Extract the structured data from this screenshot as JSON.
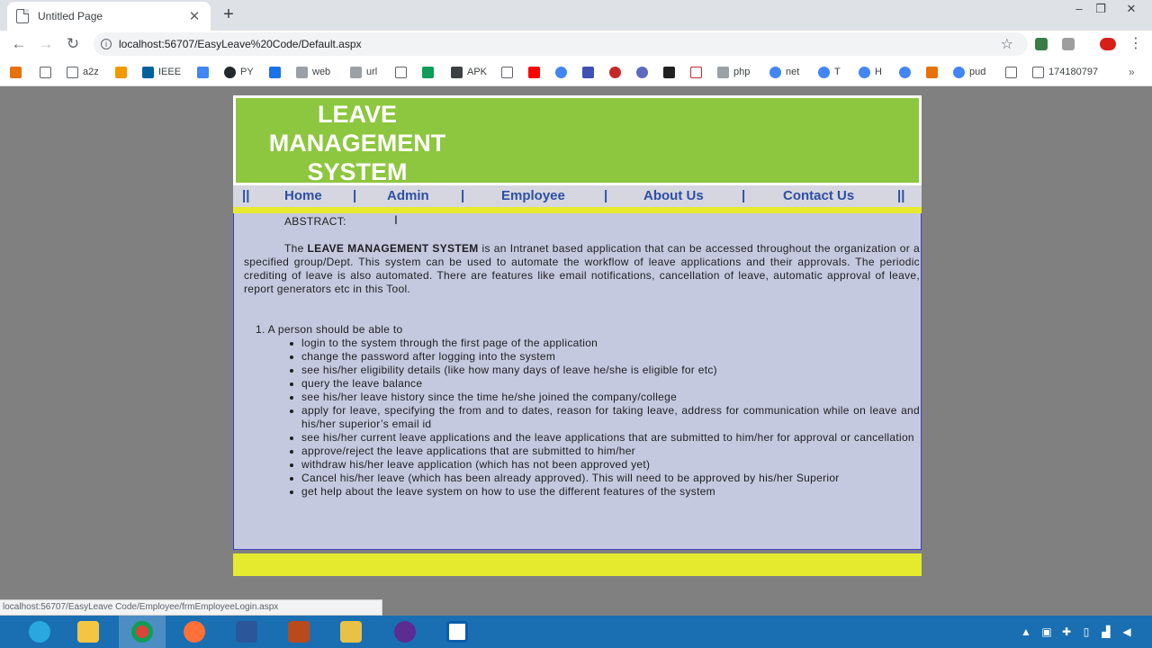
{
  "browser": {
    "tab_title": "Untitled Page",
    "url": "localhost:56707/EasyLeave%20Code/Default.aspx",
    "status_url": "localhost:56707/EasyLeave Code/Employee/frmEmployeeLogin.aspx",
    "bookmarks": [
      "a2z",
      "IEEE",
      "PY",
      "web",
      "url",
      "APK",
      "php",
      "net",
      "T",
      "H",
      "pud",
      "174180797"
    ]
  },
  "header": {
    "logo_line1": "LEAVE",
    "logo_line2": "MANAGEMENT",
    "logo_line3": "SYSTEM"
  },
  "nav": {
    "separator": "|",
    "double_separator": "||",
    "items": [
      "Home",
      "Admin",
      "Employee",
      "About Us",
      "Contact Us"
    ]
  },
  "content": {
    "abstract_label": "ABSTRACT:",
    "para_prefix": "The ",
    "para_bold": "LEAVE MANAGEMENT SYSTEM",
    "para_rest": " is an Intranet based application that can be accessed throughout the organization or a specified group/Dept. This system can be used to automate the workflow of leave applications and their approvals. The periodic crediting of leave is also automated. There are features like email notifications, cancellation of leave, automatic approval of leave, report generators etc in this Tool.",
    "list_title": "1. A person should be able to",
    "bullets": [
      "login to the system through the first page of the application",
      "change the password after logging into the system",
      "see his/her eligibility details (like how many days of leave he/she is eligible for etc)",
      "query the leave balance",
      "see his/her leave history since the time he/she joined the company/college",
      "apply for leave, specifying the from and to dates, reason for taking leave, address for communication while on leave and his/her superior’s email id",
      "see his/her current leave applications and the leave applications that are submitted to him/her for approval or cancellation",
      "approve/reject the leave applications that are submitted to him/her",
      "withdraw his/her leave application (which has not been approved yet)",
      "Cancel his/her leave (which has been already approved). This will need to be approved by his/her Superior",
      "get help about the leave system on how to use the different features of the system"
    ]
  },
  "colors": {
    "header_green": "#8dc63f",
    "nav_bg": "#d6d6e0",
    "nav_text": "#2d4fa3",
    "accent_yellow": "#e5ea2f",
    "content_bg": "#c4c9e0",
    "page_bg": "#808080",
    "taskbar": "#1a6fb3"
  }
}
